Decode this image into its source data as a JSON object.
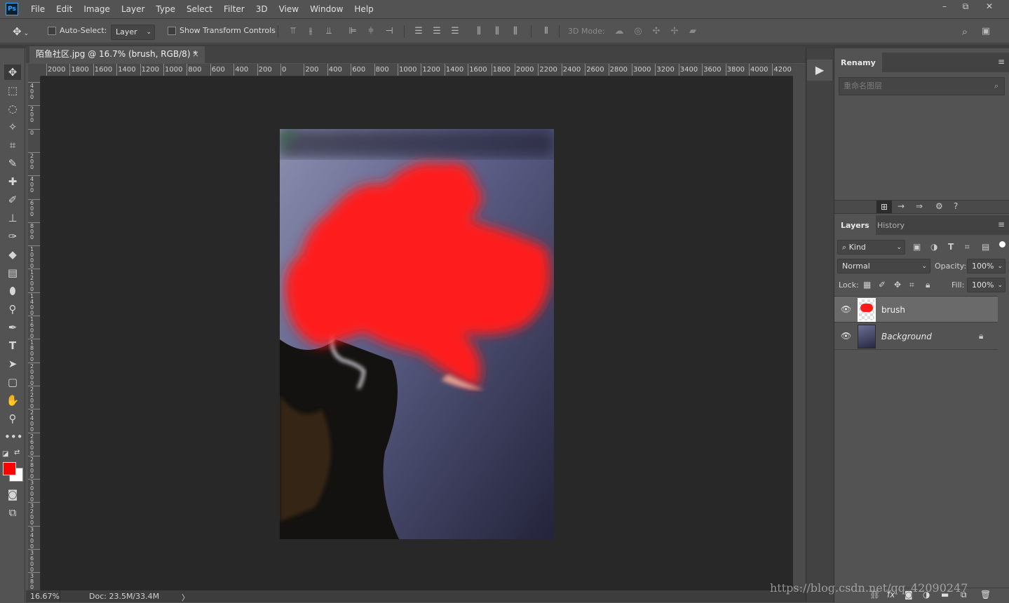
{
  "app": {
    "logo": "Ps"
  },
  "menu": [
    "File",
    "Edit",
    "Image",
    "Layer",
    "Type",
    "Select",
    "Filter",
    "3D",
    "View",
    "Window",
    "Help"
  ],
  "window_controls": {
    "minimize": "–",
    "restore": "⧉",
    "close": "✕"
  },
  "options": {
    "auto_select_label": "Auto-Select:",
    "auto_select_value": "Layer",
    "transform_label": "Show Transform Controls",
    "mode_label": "3D Mode:"
  },
  "document": {
    "tab_title": "陌鱼社区.jpg @ 16.7% (brush, RGB/8) *",
    "tab_close": "×",
    "zoom": "16.67%",
    "doc_size": "Doc: 23.5M/33.4M",
    "status_arrow": "〉"
  },
  "ruler": {
    "h_labels": [
      "2000",
      "1800",
      "1600",
      "1400",
      "1200",
      "1000",
      "800",
      "600",
      "400",
      "200",
      "0",
      "200",
      "400",
      "600",
      "800",
      "1000",
      "1200",
      "1400",
      "1600",
      "1800",
      "2000",
      "2200",
      "2400",
      "2600",
      "2800",
      "3000",
      "3200",
      "3400",
      "3600",
      "3800",
      "4000",
      "4200"
    ],
    "v_labels": [
      "400",
      "200",
      "0",
      "200",
      "400",
      "600",
      "800",
      "1000",
      "1200",
      "1400",
      "1600",
      "1800",
      "2000",
      "2200",
      "2400",
      "2600",
      "2800",
      "3000",
      "3200",
      "3400",
      "3600",
      "3800"
    ]
  },
  "colors": {
    "foreground": "#ff0000",
    "background": "#ffffff",
    "accent": "#31a8ff",
    "brush_red": "#ff1a1a"
  },
  "renamy": {
    "tab": "Renamy",
    "placeholder": "重命名图层",
    "menu_icon": "≡"
  },
  "layers_panel": {
    "tabs": [
      "Layers",
      "History"
    ],
    "kind_label": "Kind",
    "blend_mode": "Normal",
    "opacity_label": "Opacity:",
    "opacity_value": "100%",
    "lock_label": "Lock:",
    "fill_label": "Fill:",
    "fill_value": "100%",
    "layers": [
      {
        "name": "brush",
        "selected": true
      },
      {
        "name": "Background",
        "locked": true
      }
    ],
    "footer_icons": [
      "link-icon",
      "fx-icon",
      "mask-icon",
      "adjustment-icon",
      "folder-icon",
      "new-layer-icon",
      "trash-icon"
    ]
  },
  "watermark": "https://blog.csdn.net/qq_42090247"
}
